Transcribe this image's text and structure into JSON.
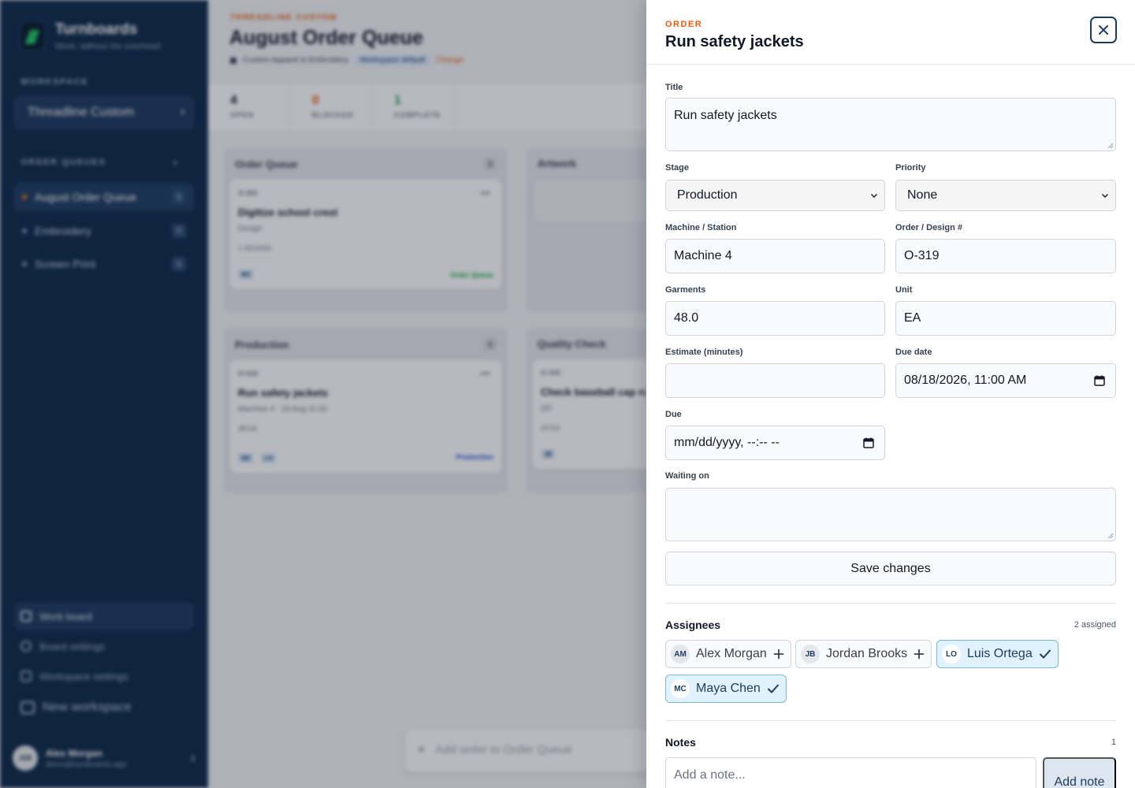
{
  "brand": {
    "name": "Turnboards",
    "tagline": "Work, without the overhead"
  },
  "sidebar": {
    "workspace_label": "WORKSPACE",
    "workspace_value": "Threadline Custom",
    "queues_label": "ORDER QUEUES",
    "add_symbol": "+",
    "queues": [
      {
        "name": "August Order Queue",
        "count": "5"
      },
      {
        "name": "Embroidery",
        "count": "0"
      },
      {
        "name": "Screen Print",
        "count": "0"
      }
    ],
    "nav": [
      {
        "label": "Work board"
      },
      {
        "label": "Board settings"
      },
      {
        "label": "Workspace settings"
      },
      {
        "label": "New workspace"
      }
    ],
    "user": {
      "initials": "AM",
      "name": "Alex Morgan",
      "email": "demo@turnboards.app"
    }
  },
  "board": {
    "kicker": "THREADLINE CUSTOM",
    "title": "August Order Queue",
    "meta": {
      "category": "Custom Apparel & Embroidery",
      "tag": "Workspace default",
      "link": "Change"
    },
    "stats": [
      {
        "value": "4",
        "label": "OPEN",
        "color": "#111827"
      },
      {
        "value": "0",
        "label": "BLOCKED",
        "color": "#ea580c"
      },
      {
        "value": "1",
        "label": "COMPLETE",
        "color": "#16a34a"
      }
    ],
    "columns": [
      {
        "name": "Order Queue",
        "count": "1",
        "cards": [
          {
            "id": "O-302",
            "title": "Digitize school crest",
            "meta": "Design",
            "qty": "1 DESIGN",
            "assignees": [
              "MC"
            ],
            "stage": "Order Queue"
          }
        ]
      },
      {
        "name": "Artwork",
        "count": "",
        "cards": []
      },
      {
        "name": "Production",
        "count": "1",
        "cards": [
          {
            "id": "O-319",
            "title": "Run safety jackets",
            "meta": "Machine 4 · 18 Aug 11:00",
            "qty": "48 EA",
            "assignees": [
              "MC",
              "LO"
            ],
            "stage": "Production"
          }
        ]
      },
      {
        "name": "Quality Check",
        "count": "",
        "cards": [
          {
            "id": "O-315",
            "title": "Check baseball cap run",
            "meta": "QC",
            "qty": "24 EA",
            "assignees": [
              "JB"
            ],
            "stage": ""
          }
        ]
      }
    ],
    "add_order": "Add order to Order Queue"
  },
  "drawer": {
    "kicker": "ORDER",
    "title": "Run safety jackets",
    "close_icon": "close-icon",
    "fields": {
      "title": {
        "label": "Title",
        "value": "Run safety jackets"
      },
      "stage": {
        "label": "Stage",
        "value": "Production"
      },
      "priority": {
        "label": "Priority",
        "value": "None"
      },
      "machine": {
        "label": "Machine / Station",
        "value": "Machine 4"
      },
      "order": {
        "label": "Order / Design #",
        "value": "O-319"
      },
      "garments": {
        "label": "Garments",
        "value": "48.0"
      },
      "unit": {
        "label": "Unit",
        "value": "EA"
      },
      "estimate": {
        "label": "Estimate (minutes)",
        "value": ""
      },
      "due_date": {
        "label": "Due date",
        "value": "08/18/2026, 11:00 AM"
      },
      "due": {
        "label": "Due",
        "value": "mm/dd/yyyy, --:-- --"
      },
      "waiting": {
        "label": "Waiting on",
        "value": ""
      }
    },
    "save_label": "Save changes",
    "assignees": {
      "title": "Assignees",
      "count_text": "2 assigned",
      "people": [
        {
          "initials": "AM",
          "name": "Alex Morgan",
          "assigned": false
        },
        {
          "initials": "JB",
          "name": "Jordan Brooks",
          "assigned": false
        },
        {
          "initials": "LO",
          "name": "Luis Ortega",
          "assigned": true
        },
        {
          "initials": "MC",
          "name": "Maya Chen",
          "assigned": true
        }
      ]
    },
    "notes": {
      "title": "Notes",
      "count": "1",
      "placeholder": "Add a note...",
      "button": "Add note"
    }
  },
  "colors": {
    "accent": "#ea580c",
    "navy": "#0f2a4a",
    "assigned_bg": "#e0f2fe"
  }
}
